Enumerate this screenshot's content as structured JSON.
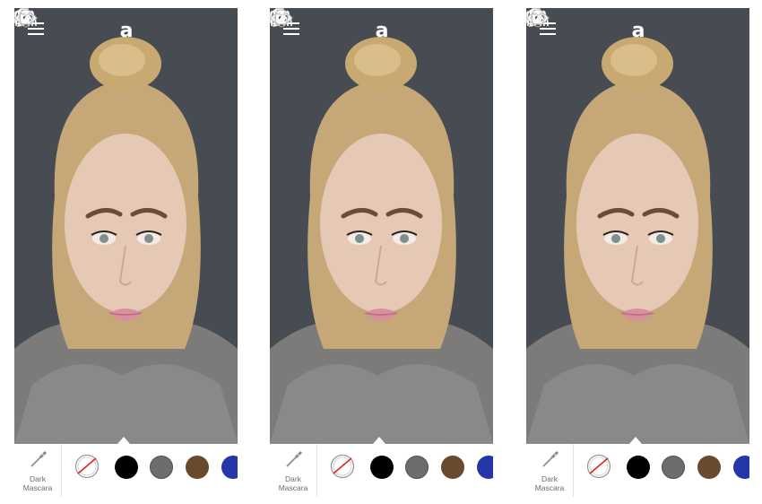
{
  "app": {
    "logo_text": "a"
  },
  "icons": [
    "menu-icon",
    "camera-icon",
    "info-icon",
    "trash-icon",
    "eye-icon",
    "brush-icon",
    "eyebrow-icon",
    "face-icon",
    "lips-icon",
    "mascara-wand-icon",
    "no-color-icon"
  ],
  "screens": [
    {
      "product": {
        "label_line1": "Dark",
        "label_line2": "Mascara"
      }
    },
    {
      "product": {
        "label_line1": "Dark",
        "label_line2": "Mascara"
      }
    },
    {
      "product": {
        "label_line1": "Dark",
        "label_line2": "Mascara"
      }
    }
  ],
  "swatch_colors": {
    "black": "#000000",
    "grey": "#6d6d6d",
    "brown": "#6a4a2d",
    "blue": "#2436a8"
  }
}
